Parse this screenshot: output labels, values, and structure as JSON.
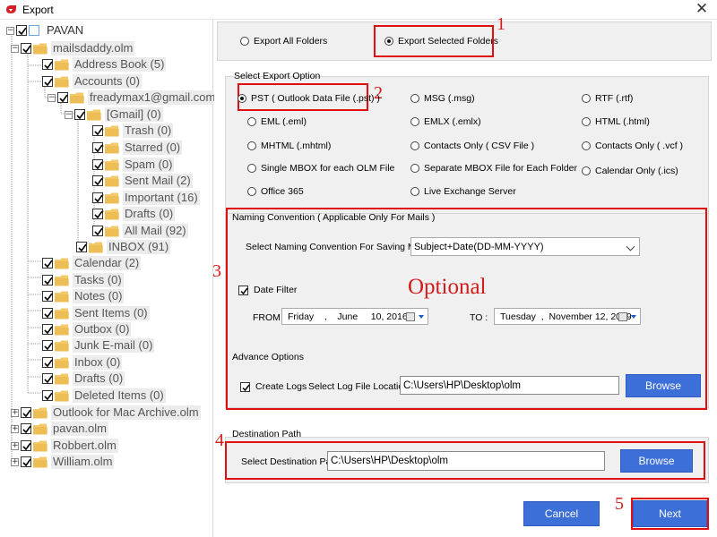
{
  "window": {
    "title": "Export",
    "close_label": "✕"
  },
  "tree": {
    "root": "PAVAN",
    "items": [
      {
        "label": "mailsdaddy.olm",
        "checked": true
      },
      {
        "label": "Address Book (5)",
        "checked": true
      },
      {
        "label": "Accounts (0)",
        "checked": true
      },
      {
        "label": "freadymax1@gmail.com",
        "checked": true
      },
      {
        "label": "[Gmail] (0)",
        "checked": true
      },
      {
        "label": "Trash (0)",
        "checked": true
      },
      {
        "label": "Starred (0)",
        "checked": true
      },
      {
        "label": "Spam (0)",
        "checked": true
      },
      {
        "label": "Sent Mail (2)",
        "checked": true
      },
      {
        "label": "Important (16)",
        "checked": true
      },
      {
        "label": "Drafts (0)",
        "checked": true
      },
      {
        "label": "All Mail (92)",
        "checked": true
      },
      {
        "label": "INBOX (91)",
        "checked": true
      },
      {
        "label": "Calendar (2)",
        "checked": true
      },
      {
        "label": "Tasks (0)",
        "checked": true
      },
      {
        "label": "Notes (0)",
        "checked": true
      },
      {
        "label": "Sent Items (0)",
        "checked": true
      },
      {
        "label": "Outbox (0)",
        "checked": true
      },
      {
        "label": "Junk E-mail (0)",
        "checked": true
      },
      {
        "label": "Inbox (0)",
        "checked": true
      },
      {
        "label": "Drafts (0)",
        "checked": true
      },
      {
        "label": "Deleted Items (0)",
        "checked": true
      },
      {
        "label": "Outlook for Mac Archive.olm",
        "checked": true
      },
      {
        "label": "pavan.olm",
        "checked": true
      },
      {
        "label": "Robbert.olm",
        "checked": true
      },
      {
        "label": "William.olm",
        "checked": true
      }
    ]
  },
  "export_mode": {
    "all_label": "Export All Folders",
    "selected_label": "Export Selected Folders",
    "selected": "selected"
  },
  "export_option": {
    "title": "Select Export Option",
    "options": [
      {
        "label": "PST ( Outlook Data File (.pst) )",
        "selected": true
      },
      {
        "label": "MSG  (.msg)",
        "selected": false
      },
      {
        "label": "RTF  (.rtf)",
        "selected": false
      },
      {
        "label": "EML  (.eml)",
        "selected": false
      },
      {
        "label": "EMLX  (.emlx)",
        "selected": false
      },
      {
        "label": "HTML  (.html)",
        "selected": false
      },
      {
        "label": "MHTML (.mhtml)",
        "selected": false
      },
      {
        "label": "Contacts Only  ( CSV File )",
        "selected": false
      },
      {
        "label": "Contacts Only  ( .vcf )",
        "selected": false
      },
      {
        "label": "Single MBOX for each OLM File",
        "selected": false
      },
      {
        "label": "Separate MBOX File for Each Folder",
        "selected": false
      },
      {
        "label": "Calendar Only  (.ics)",
        "selected": false
      },
      {
        "label": "Office 365",
        "selected": false
      },
      {
        "label": "Live Exchange Server",
        "selected": false
      }
    ]
  },
  "naming": {
    "title": "Naming Convention ( Applicable Only For Mails )",
    "label": "Select Naming Convention For Saving Mails",
    "value": "Subject+Date(DD-MM-YYYY)"
  },
  "date_filter": {
    "label": "Date Filter",
    "checked": true,
    "from_label": "FROM :",
    "from_value": "Friday    ,    June     10, 2016",
    "to_label": "TO :",
    "to_value": "Tuesday  ,  November 12, 2019"
  },
  "advance": {
    "title": "Advance Options",
    "create_logs_label": "Create Logs",
    "create_logs_checked": true,
    "log_location_label": "Select Log File Location :",
    "log_location_value": "C:\\Users\\HP\\Desktop\\olm",
    "browse_label": "Browse"
  },
  "destination": {
    "title": "Destination Path",
    "label": "Select Destination Path",
    "value": "C:\\Users\\HP\\Desktop\\olm",
    "browse_label": "Browse"
  },
  "buttons": {
    "cancel_label": "Cancel",
    "next_label": "Next"
  },
  "annotations": {
    "n1": "1",
    "n2": "2",
    "n3": "3",
    "n4": "4",
    "n5": "5",
    "optional": "Optional"
  },
  "colors": {
    "accent_blue": "#3d6fd9",
    "annotation_red": "#e01010",
    "panel_bg": "#f0f0f0"
  }
}
